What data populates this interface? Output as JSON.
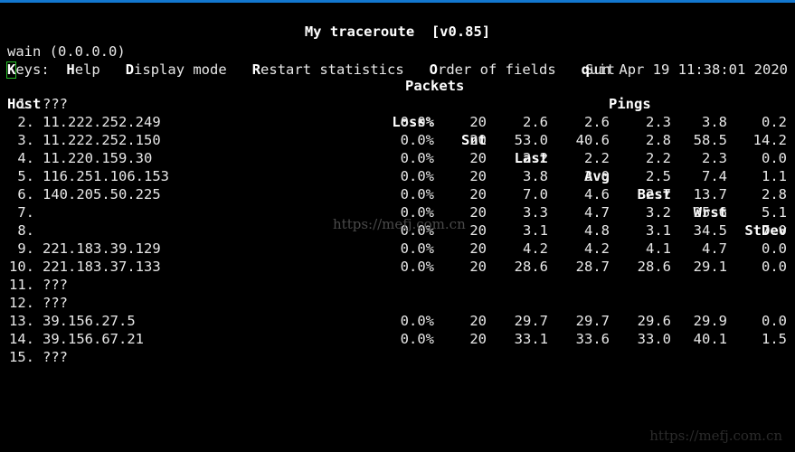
{
  "window": {
    "accent_color": "#1277cf",
    "background_color": "#000000",
    "foreground_color": "#e8e8e8",
    "cursor_color": "#25c025"
  },
  "header": {
    "title": "My traceroute  [v0.85]",
    "local_host": "wain (0.0.0.0)",
    "timestamp": "Sun Apr 19 11:38:01 2020"
  },
  "keys": {
    "label": "Keys:",
    "label_hotkey": "K",
    "label_rest": "eys:",
    "items": [
      {
        "hotkey": "H",
        "rest": "elp"
      },
      {
        "hotkey": "D",
        "rest": "isplay mode"
      },
      {
        "hotkey": "R",
        "rest": "estart statistics"
      },
      {
        "hotkey": "O",
        "rest": "rder of fields"
      },
      {
        "hotkey": "q",
        "rest": "uit"
      }
    ]
  },
  "table": {
    "group_headers": {
      "packets": "Packets",
      "pings": "Pings"
    },
    "columns": {
      "host": "Host",
      "loss": "Loss%",
      "snt": "Snt",
      "last": "Last",
      "avg": "Avg",
      "best": "Best",
      "wrst": "Wrst",
      "stdev": "StDev"
    },
    "rows": [
      {
        "idx": "1.",
        "host": "???",
        "loss": "",
        "snt": "",
        "last": "",
        "avg": "",
        "best": "",
        "wrst": "",
        "stdev": ""
      },
      {
        "idx": "2.",
        "host": "11.222.252.249",
        "loss": "0.0%",
        "snt": "20",
        "last": "2.6",
        "avg": "2.6",
        "best": "2.3",
        "wrst": "3.8",
        "stdev": "0.2"
      },
      {
        "idx": "3.",
        "host": "11.222.252.150",
        "loss": "0.0%",
        "snt": "20",
        "last": "53.0",
        "avg": "40.6",
        "best": "2.8",
        "wrst": "58.5",
        "stdev": "14.2"
      },
      {
        "idx": "4.",
        "host": "11.220.159.30",
        "loss": "0.0%",
        "snt": "20",
        "last": "2.2",
        "avg": "2.2",
        "best": "2.2",
        "wrst": "2.3",
        "stdev": "0.0"
      },
      {
        "idx": "5.",
        "host": "116.251.106.153",
        "loss": "0.0%",
        "snt": "20",
        "last": "3.8",
        "avg": "3.0",
        "best": "2.5",
        "wrst": "7.4",
        "stdev": "1.1"
      },
      {
        "idx": "6.",
        "host": "140.205.50.225",
        "loss": "0.0%",
        "snt": "20",
        "last": "7.0",
        "avg": "4.6",
        "best": "2.7",
        "wrst": "13.7",
        "stdev": "2.8"
      },
      {
        "idx": "7.",
        "host": "",
        "loss": "0.0%",
        "snt": "20",
        "last": "3.3",
        "avg": "4.7",
        "best": "3.2",
        "wrst": "25.6",
        "stdev": "5.1"
      },
      {
        "idx": "8.",
        "host": "",
        "loss": "0.0%",
        "snt": "20",
        "last": "3.1",
        "avg": "4.8",
        "best": "3.1",
        "wrst": "34.5",
        "stdev": "7.0"
      },
      {
        "idx": "9.",
        "host": "221.183.39.129",
        "loss": "0.0%",
        "snt": "20",
        "last": "4.2",
        "avg": "4.2",
        "best": "4.1",
        "wrst": "4.7",
        "stdev": "0.0"
      },
      {
        "idx": "10.",
        "host": "221.183.37.133",
        "loss": "0.0%",
        "snt": "20",
        "last": "28.6",
        "avg": "28.7",
        "best": "28.6",
        "wrst": "29.1",
        "stdev": "0.0"
      },
      {
        "idx": "11.",
        "host": "???",
        "loss": "",
        "snt": "",
        "last": "",
        "avg": "",
        "best": "",
        "wrst": "",
        "stdev": ""
      },
      {
        "idx": "12.",
        "host": "???",
        "loss": "",
        "snt": "",
        "last": "",
        "avg": "",
        "best": "",
        "wrst": "",
        "stdev": ""
      },
      {
        "idx": "13.",
        "host": "39.156.27.5",
        "loss": "0.0%",
        "snt": "20",
        "last": "29.7",
        "avg": "29.7",
        "best": "29.6",
        "wrst": "29.9",
        "stdev": "0.0"
      },
      {
        "idx": "14.",
        "host": "39.156.67.21",
        "loss": "0.0%",
        "snt": "20",
        "last": "33.1",
        "avg": "33.6",
        "best": "33.0",
        "wrst": "40.1",
        "stdev": "1.5"
      },
      {
        "idx": "15.",
        "host": "???",
        "loss": "",
        "snt": "",
        "last": "",
        "avg": "",
        "best": "",
        "wrst": "",
        "stdev": ""
      }
    ]
  },
  "watermarks": {
    "center": "https://mefj.com.cn",
    "corner": "https://mefj.com.cn"
  }
}
